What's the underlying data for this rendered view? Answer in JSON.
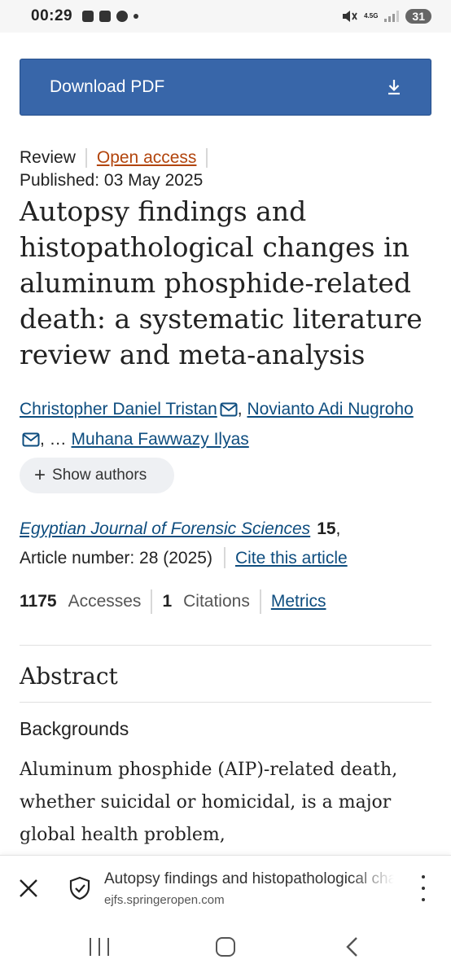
{
  "status_bar": {
    "time": "00:29",
    "network": "4.5G",
    "battery": "31"
  },
  "download": {
    "label": "Download PDF"
  },
  "article": {
    "type": "Review",
    "access": "Open access",
    "published": "Published: 03 May 2025",
    "title": "Autopsy findings and histopathological changes in aluminum phosphide-related death: a systematic literature review and meta-analysis"
  },
  "authors": {
    "first": "Christopher Daniel Tristan",
    "second": "Novianto Adi Nugroho",
    "separator": ", ",
    "ellipsis": ", … ",
    "last": "Muhana Fawwazy Ilyas",
    "show_label": "Show authors"
  },
  "journal": {
    "name": "Egyptian Journal of Forensic Sciences",
    "volume": "15",
    "volume_suffix": ",",
    "article_number": "Article number: 28 (2025)",
    "cite_label": "Cite this article"
  },
  "stats": {
    "accesses_count": "1175",
    "accesses_label": "Accesses",
    "citations_count": "1",
    "citations_label": "Citations",
    "metrics_label": "Metrics"
  },
  "abstract": {
    "heading": "Abstract",
    "subheading": "Backgrounds",
    "text": "Aluminum phosphide (AIP)-related death, whether suicidal or homicidal, is a major global health problem,"
  },
  "browser_bar": {
    "page_title": "Autopsy findings and histopathological changes in aluminum phosphide-related death",
    "url": "ejfs.springeropen.com"
  },
  "colors": {
    "button_blue": "#3866a9",
    "link_blue": "#0e4d7f",
    "open_access_orange": "#b2450d"
  }
}
